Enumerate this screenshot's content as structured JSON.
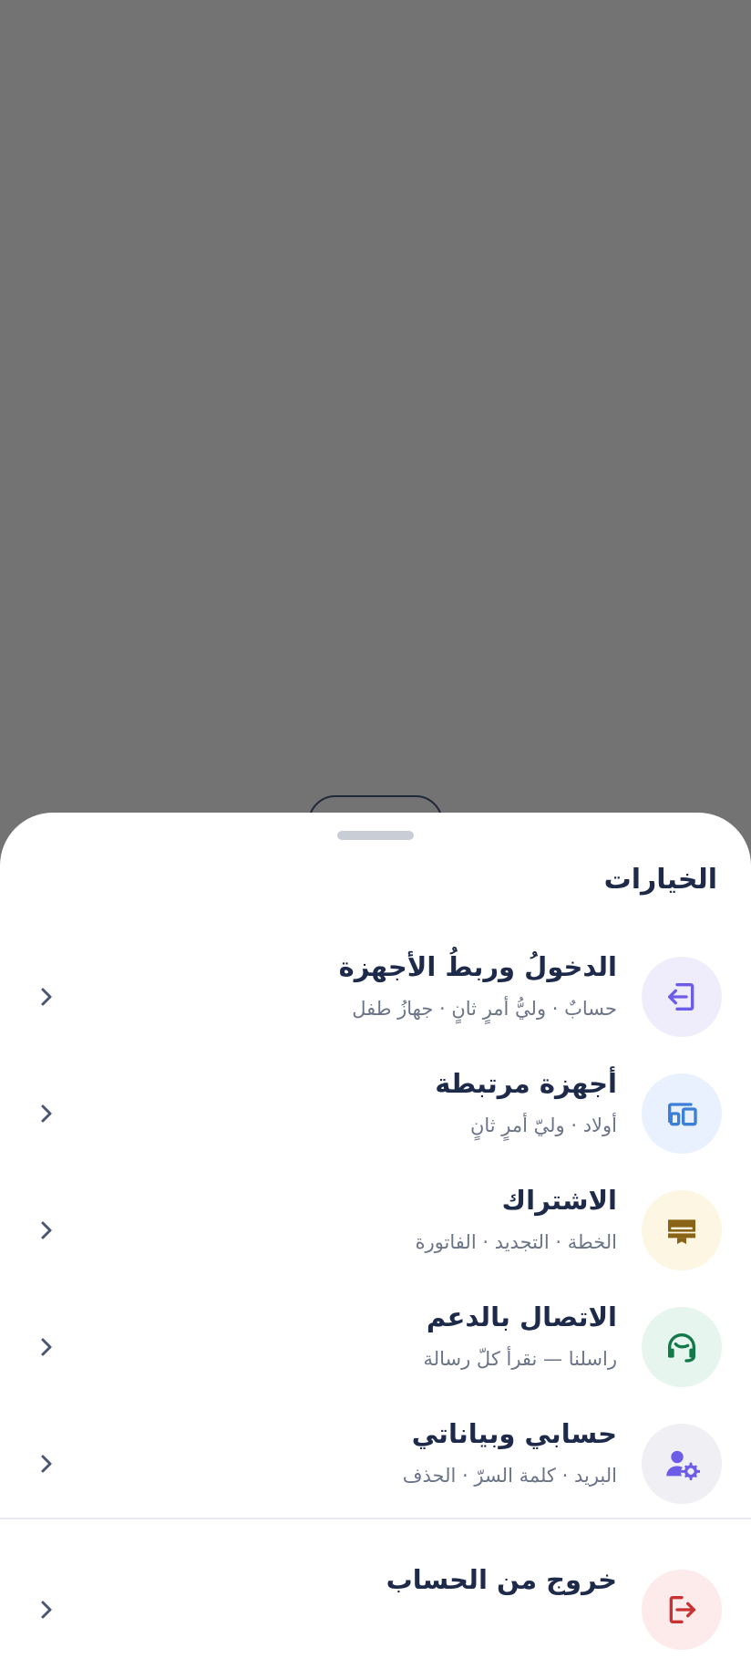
{
  "sheet": {
    "title": "الخيارات"
  },
  "items": [
    {
      "title": "الدخولُ وربطُ الأجهزة",
      "subtitle": "حسابٌ · وليُّ أمرٍ ثانٍ · جهازُ طفل",
      "icon": "login-icon",
      "color": "#6d5ce8",
      "bg": "#efedfc"
    },
    {
      "title": "أجهزة مرتبطة",
      "subtitle": "أولاد · وليّ أمرٍ ثانٍ",
      "icon": "devices-icon",
      "color": "#3b7fd9",
      "bg": "#e8f1fd"
    },
    {
      "title": "الاشتراك",
      "subtitle": "الخطة · التجديد · الفاتورة",
      "icon": "subscription-card-icon",
      "color": "#8a6416",
      "bg": "#fdf6e3"
    },
    {
      "title": "الاتصال بالدعم",
      "subtitle": "راسلنا — نقرأ كلّ رسالة",
      "icon": "support-headset-icon",
      "color": "#13784a",
      "bg": "#e6f6ee"
    },
    {
      "title": "حسابي وبياناتي",
      "subtitle": "البريد · كلمة السرّ · الحذف",
      "icon": "account-settings-icon",
      "color": "#6d5ce8",
      "bg": "#efeff4"
    }
  ],
  "logout": {
    "title": "خروج من الحساب",
    "icon": "logout-icon",
    "color": "#c83232",
    "bg": "#fdebeb"
  }
}
